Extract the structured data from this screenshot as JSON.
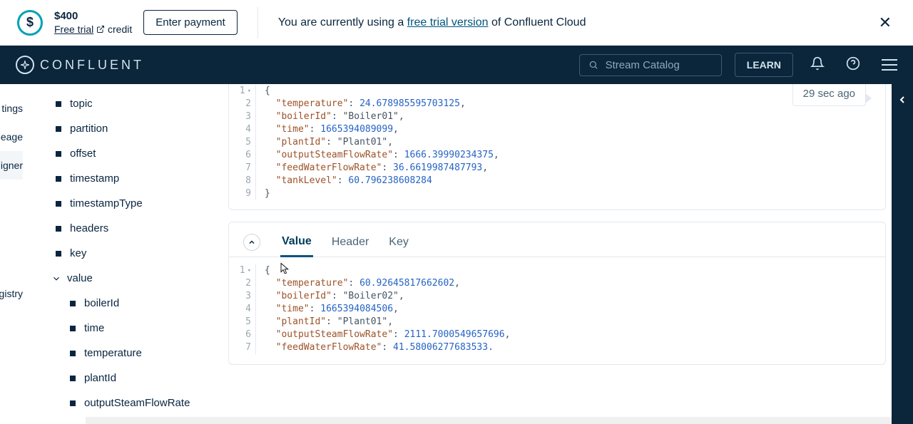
{
  "banner": {
    "credit_amount": "$400",
    "free_trial_link": "Free trial",
    "credit_suffix": "credit",
    "enter_payment": "Enter payment",
    "msg_prefix": "You are currently using a ",
    "msg_link": "free trial version",
    "msg_suffix": " of Confluent Cloud"
  },
  "nav": {
    "logo": "CONFLUENT",
    "search_placeholder": "Stream Catalog",
    "learn": "LEARN"
  },
  "far_left_items": [
    "tings",
    "eage",
    "igner",
    "gistry"
  ],
  "far_left_active_index": 2,
  "fields": {
    "top": [
      "topic",
      "partition",
      "offset",
      "timestamp",
      "timestampType",
      "headers",
      "key"
    ],
    "expand": "value",
    "sub": [
      "boilerId",
      "time",
      "temperature",
      "plantId",
      "outputSteamFlowRate"
    ]
  },
  "timestamp_pill": "29 sec ago",
  "tabs": {
    "value": "Value",
    "header": "Header",
    "key": "Key"
  },
  "msg1": {
    "temperature": 24.678985595703125,
    "boilerId": "Boiler01",
    "time": 1665394089099,
    "plantId": "Plant01",
    "outputSteamFlowRate": 1666.39990234375,
    "feedWaterFlowRate": 36.6619987487793,
    "tankLevel": 60.796238608284
  },
  "msg2": {
    "temperature": 60.92645817662602,
    "boilerId": "Boiler02",
    "time": 1665394084506,
    "plantId": "Plant01",
    "outputSteamFlowRate": 2111.7000549657696,
    "feedWaterFlowRate_partial": "41.58006277683533."
  }
}
